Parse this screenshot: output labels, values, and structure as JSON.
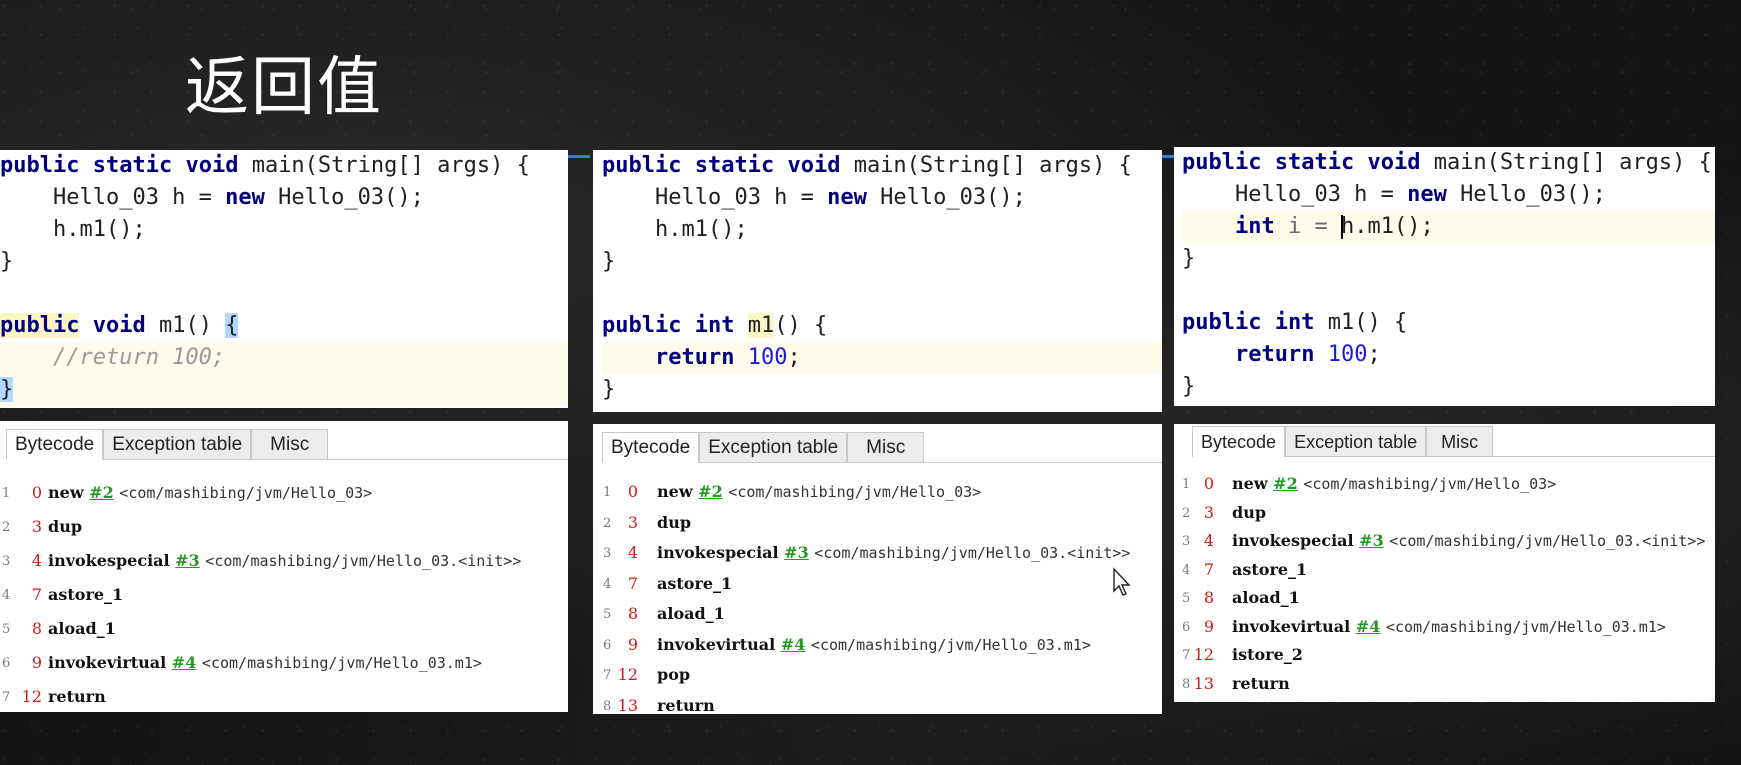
{
  "title": "返回值",
  "tabs": [
    "Bytecode",
    "Exception table",
    "Misc"
  ],
  "panels": [
    {
      "code": {
        "l1": [
          "public",
          "static",
          "void",
          " main(String[] args) {"
        ],
        "l2": [
          "    Hello_03 h = ",
          "new",
          " Hello_03();"
        ],
        "l3": "    h.m1();",
        "l4": "}",
        "l6": [
          "public",
          "void",
          " m1() ",
          "{"
        ],
        "l7": "    //return 100;",
        "l8": "}"
      },
      "bytecode": [
        {
          "n": "1",
          "off": "0",
          "op": "new",
          "ref": "#2",
          "desc": "<com/mashibing/jvm/Hello_03>"
        },
        {
          "n": "2",
          "off": "3",
          "op": "dup",
          "ref": "",
          "desc": ""
        },
        {
          "n": "3",
          "off": "4",
          "op": "invokespecial",
          "ref": "#3",
          "desc": "<com/mashibing/jvm/Hello_03.<init>>"
        },
        {
          "n": "4",
          "off": "7",
          "op": "astore_1",
          "ref": "",
          "desc": ""
        },
        {
          "n": "5",
          "off": "8",
          "op": "aload_1",
          "ref": "",
          "desc": ""
        },
        {
          "n": "6",
          "off": "9",
          "op": "invokevirtual",
          "ref": "#4",
          "desc": "<com/mashibing/jvm/Hello_03.m1>"
        },
        {
          "n": "7",
          "off": "12",
          "op": "return",
          "ref": "",
          "desc": ""
        }
      ]
    },
    {
      "code": {
        "l1": [
          "public",
          "static",
          "void",
          " main(String[] args) {"
        ],
        "l2": [
          "    Hello_03 h = ",
          "new",
          " Hello_03();"
        ],
        "l3": "    h.m1();",
        "l4": "}",
        "l6": [
          "public",
          "int",
          "m1",
          "() {"
        ],
        "l7": [
          "    ",
          "return",
          "100",
          ";"
        ],
        "l8": "}"
      },
      "bytecode": [
        {
          "n": "1",
          "off": "0",
          "op": "new",
          "ref": "#2",
          "desc": "<com/mashibing/jvm/Hello_03>"
        },
        {
          "n": "2",
          "off": "3",
          "op": "dup",
          "ref": "",
          "desc": ""
        },
        {
          "n": "3",
          "off": "4",
          "op": "invokespecial",
          "ref": "#3",
          "desc": "<com/mashibing/jvm/Hello_03.<init>>"
        },
        {
          "n": "4",
          "off": "7",
          "op": "astore_1",
          "ref": "",
          "desc": ""
        },
        {
          "n": "5",
          "off": "8",
          "op": "aload_1",
          "ref": "",
          "desc": ""
        },
        {
          "n": "6",
          "off": "9",
          "op": "invokevirtual",
          "ref": "#4",
          "desc": "<com/mashibing/jvm/Hello_03.m1>"
        },
        {
          "n": "7",
          "off": "12",
          "op": "pop",
          "ref": "",
          "desc": ""
        },
        {
          "n": "8",
          "off": "13",
          "op": "return",
          "ref": "",
          "desc": ""
        }
      ]
    },
    {
      "code": {
        "l1": [
          "public",
          "static",
          "void",
          " main(String[] args) {"
        ],
        "l2": [
          "    Hello_03 h = ",
          "new",
          " Hello_03();"
        ],
        "l3": [
          "    ",
          "int",
          " i = ",
          "h.m1();"
        ],
        "l4": "}",
        "l6": [
          "public",
          "int",
          " m1() {"
        ],
        "l7": [
          "    ",
          "return",
          "100",
          ";"
        ],
        "l8": "}"
      },
      "bytecode": [
        {
          "n": "1",
          "off": "0",
          "op": "new",
          "ref": "#2",
          "desc": "<com/mashibing/jvm/Hello_03>"
        },
        {
          "n": "2",
          "off": "3",
          "op": "dup",
          "ref": "",
          "desc": ""
        },
        {
          "n": "3",
          "off": "4",
          "op": "invokespecial",
          "ref": "#3",
          "desc": "<com/mashibing/jvm/Hello_03.<init>>"
        },
        {
          "n": "4",
          "off": "7",
          "op": "astore_1",
          "ref": "",
          "desc": ""
        },
        {
          "n": "5",
          "off": "8",
          "op": "aload_1",
          "ref": "",
          "desc": ""
        },
        {
          "n": "6",
          "off": "9",
          "op": "invokevirtual",
          "ref": "#4",
          "desc": "<com/mashibing/jvm/Hello_03.m1>"
        },
        {
          "n": "7",
          "off": "12",
          "op": "istore_2",
          "ref": "",
          "desc": ""
        },
        {
          "n": "8",
          "off": "13",
          "op": "return",
          "ref": "",
          "desc": ""
        }
      ]
    }
  ]
}
